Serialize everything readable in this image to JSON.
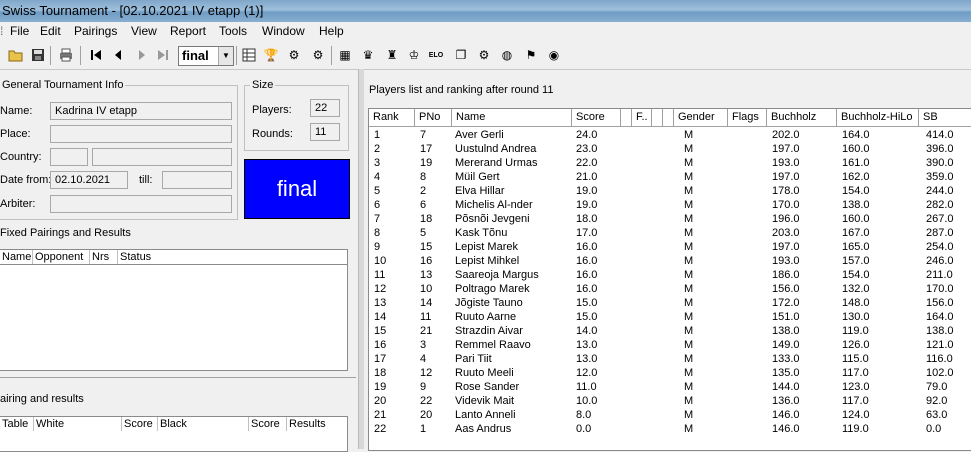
{
  "window": {
    "title": "Swiss Tournament - [02.10.2021 IV etapp (1)]"
  },
  "menu": [
    "File",
    "Edit",
    "Pairings",
    "View",
    "Report",
    "Tools",
    "Window",
    "Help"
  ],
  "toolbar": {
    "round_value": "final"
  },
  "general_info": {
    "title": "General Tournament Info",
    "name_label": "Name:",
    "name_value": "Kadrina IV etapp",
    "place_label": "Place:",
    "place_value": "",
    "country_label": "Country:",
    "country_value": "",
    "date_from_label": "Date from:",
    "date_from_value": "02.10.2021",
    "till_label": "till:",
    "till_value": "",
    "arbiter_label": "Arbiter:",
    "arbiter_value": ""
  },
  "size": {
    "title": "Size",
    "players_label": "Players:",
    "players_value": "22",
    "rounds_label": "Rounds:",
    "rounds_value": "11"
  },
  "status_box": {
    "text": "final",
    "color": "#0000ff"
  },
  "fixed_pairings": {
    "title": "Fixed Pairings and Results",
    "columns": [
      "Name",
      "Opponent",
      "Nrs",
      "Status"
    ]
  },
  "pairing_results": {
    "title": "airing and results",
    "columns": [
      "Table",
      "White",
      "Score",
      "Black",
      "Score",
      "Results"
    ]
  },
  "players": {
    "title": "Players list and ranking after round 11",
    "columns": [
      "Rank",
      "PNo",
      "Name",
      "Score",
      "",
      "F..",
      "",
      "",
      "Gender",
      "Flags",
      "Buchholz",
      "Buchholz-HiLo",
      "SB"
    ],
    "rows": [
      [
        "1",
        "7",
        "Aver Gerli",
        "24.0",
        "M",
        "202.0",
        "164.0",
        "414.0"
      ],
      [
        "2",
        "17",
        "Uustulnd Andrea",
        "23.0",
        "M",
        "197.0",
        "160.0",
        "396.0"
      ],
      [
        "3",
        "19",
        "Mererand Urmas",
        "22.0",
        "M",
        "193.0",
        "161.0",
        "390.0"
      ],
      [
        "4",
        "8",
        "Müil Gert",
        "21.0",
        "M",
        "197.0",
        "162.0",
        "359.0"
      ],
      [
        "5",
        "2",
        "Elva Hillar",
        "19.0",
        "M",
        "178.0",
        "154.0",
        "244.0"
      ],
      [
        "6",
        "6",
        "Michelis Al-nder",
        "19.0",
        "M",
        "170.0",
        "138.0",
        "282.0"
      ],
      [
        "7",
        "18",
        "Põsnõi Jevgeni",
        "18.0",
        "M",
        "196.0",
        "160.0",
        "267.0"
      ],
      [
        "8",
        "5",
        "Kask Tõnu",
        "17.0",
        "M",
        "203.0",
        "167.0",
        "287.0"
      ],
      [
        "9",
        "15",
        "Lepist Marek",
        "16.0",
        "M",
        "197.0",
        "165.0",
        "254.0"
      ],
      [
        "10",
        "16",
        "Lepist Mihkel",
        "16.0",
        "M",
        "193.0",
        "157.0",
        "246.0"
      ],
      [
        "11",
        "13",
        "Saareoja Margus",
        "16.0",
        "M",
        "186.0",
        "154.0",
        "211.0"
      ],
      [
        "12",
        "10",
        "Poltrago Marek",
        "16.0",
        "M",
        "156.0",
        "132.0",
        "170.0"
      ],
      [
        "13",
        "14",
        "Jõgiste Tauno",
        "15.0",
        "M",
        "172.0",
        "148.0",
        "156.0"
      ],
      [
        "14",
        "11",
        "Ruuto Aarne",
        "15.0",
        "M",
        "151.0",
        "130.0",
        "164.0"
      ],
      [
        "15",
        "21",
        "Strazdin Aivar",
        "14.0",
        "M",
        "138.0",
        "119.0",
        "138.0"
      ],
      [
        "16",
        "3",
        "Remmel Raavo",
        "13.0",
        "M",
        "149.0",
        "126.0",
        "121.0"
      ],
      [
        "17",
        "4",
        "Pari Tiit",
        "13.0",
        "M",
        "133.0",
        "115.0",
        "116.0"
      ],
      [
        "18",
        "12",
        "Ruuto Meeli",
        "12.0",
        "M",
        "135.0",
        "117.0",
        "102.0"
      ],
      [
        "19",
        "9",
        "Rose Sander",
        "11.0",
        "M",
        "144.0",
        "123.0",
        "79.0"
      ],
      [
        "20",
        "22",
        "Videvik Mait",
        "10.0",
        "M",
        "136.0",
        "117.0",
        "92.0"
      ],
      [
        "21",
        "20",
        "Lanto Anneli",
        "8.0",
        "M",
        "146.0",
        "124.0",
        "63.0"
      ],
      [
        "22",
        "1",
        "Aas Andrus",
        "0.0",
        "M",
        "146.0",
        "119.0",
        "0.0"
      ]
    ]
  }
}
